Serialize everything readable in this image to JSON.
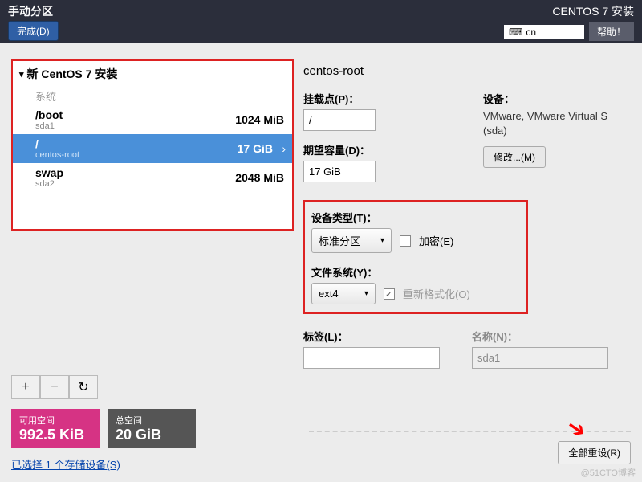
{
  "header": {
    "title": "手动分区",
    "done": "完成(D)",
    "install_title": "CENTOS 7 安装",
    "lang": "cn",
    "help": "帮助！"
  },
  "tree": {
    "title": "新 CentOS 7 安装",
    "system": "系统",
    "parts": [
      {
        "mount": "/boot",
        "dev": "sda1",
        "size": "1024 MiB"
      },
      {
        "mount": "/",
        "dev": "centos-root",
        "size": "17 GiB"
      },
      {
        "mount": "swap",
        "dev": "sda2",
        "size": "2048 MiB"
      }
    ]
  },
  "buttons": {
    "add": "+",
    "remove": "−",
    "reload": "↻"
  },
  "space": {
    "avail_label": "可用空间",
    "avail_val": "992.5 KiB",
    "total_label": "总空间",
    "total_val": "20 GiB"
  },
  "storage_link": "已选择 1 个存储设备(S)",
  "detail": {
    "volume": "centos-root",
    "mount_label": "挂载点(P)：",
    "mount_val": "/",
    "cap_label": "期望容量(D)：",
    "cap_val": "17 GiB",
    "dev_label": "设备：",
    "dev_text": "VMware, VMware Virtual S (sda)",
    "modify": "修改...(M)",
    "type_label": "设备类型(T)：",
    "type_val": "标准分区",
    "encrypt": "加密(E)",
    "fs_label": "文件系统(Y)：",
    "fs_val": "ext4",
    "reformat": "重新格式化(O)",
    "tag_label": "标签(L)：",
    "tag_val": "",
    "name_label": "名称(N)：",
    "name_val": "sda1",
    "reset": "全部重设(R)"
  },
  "watermark": "@51CTO博客"
}
